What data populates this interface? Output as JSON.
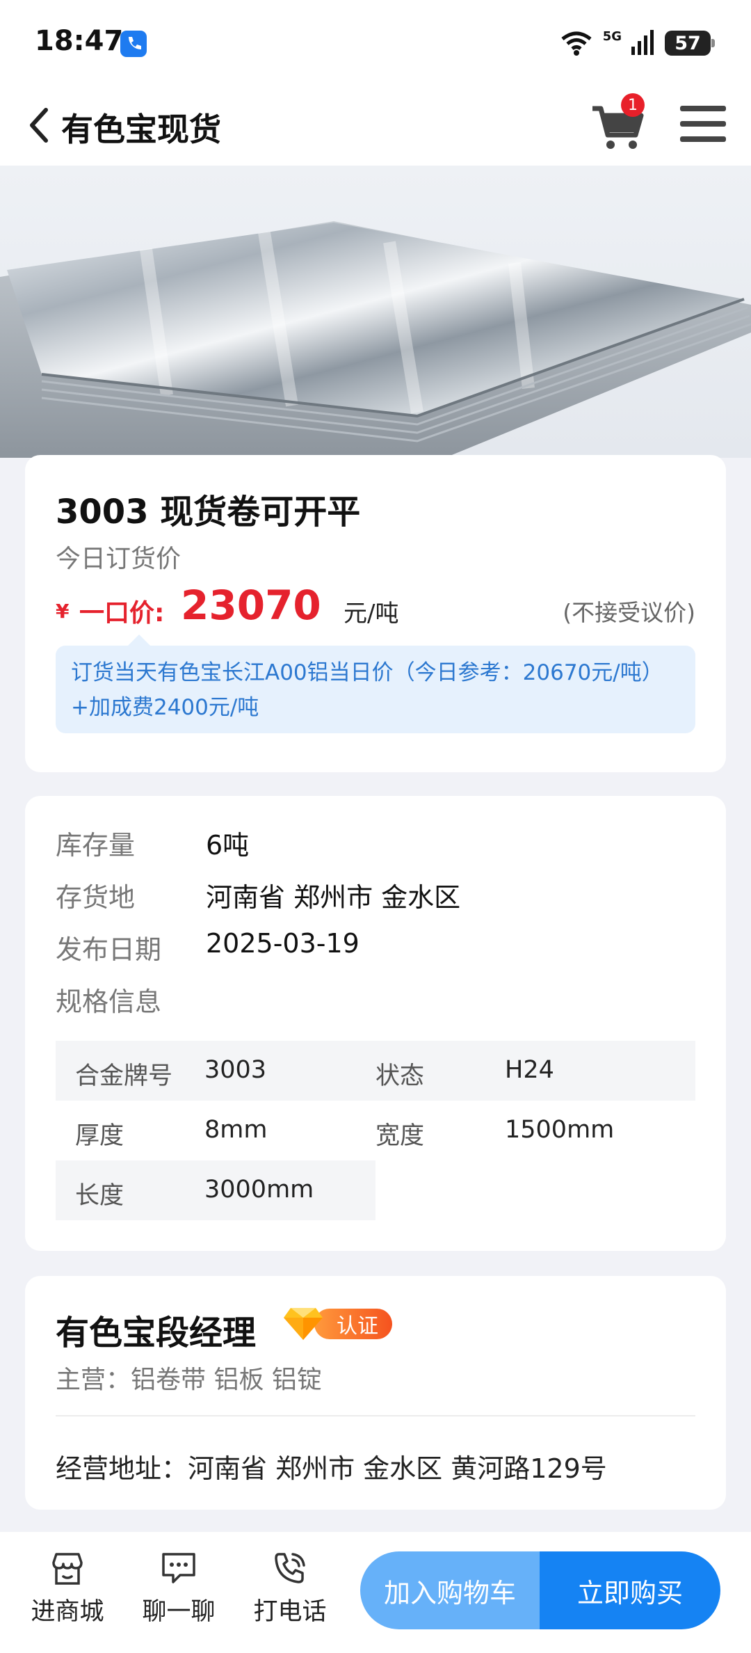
{
  "status_bar": {
    "time": "18:47",
    "network": "5G",
    "battery": "57"
  },
  "header": {
    "title": "有色宝现货",
    "cart_count": "1"
  },
  "product": {
    "title": "3003 现货卷可开平",
    "price_subtitle": "今日订货价",
    "currency_symbol": "¥",
    "price_label": "一口价:",
    "price_value": "23070",
    "price_unit": "元/吨",
    "price_note": "(不接受议价)",
    "price_info_line1": "订货当天有色宝长江A00铝当日价（今日参考：20670元/吨）",
    "price_info_line2": "+加成费2400元/吨"
  },
  "info": {
    "rows": [
      {
        "label": "库存量",
        "value": "6吨"
      },
      {
        "label": "存货地",
        "value": "河南省 郑州市 金水区"
      },
      {
        "label": "发布日期",
        "value": "2025-03-19"
      },
      {
        "label": "规格信息",
        "value": ""
      }
    ],
    "specs": [
      {
        "label": "合金牌号",
        "value": "3003"
      },
      {
        "label": "状态",
        "value": "H24"
      },
      {
        "label": "厚度",
        "value": "8mm"
      },
      {
        "label": "宽度",
        "value": "1500mm"
      },
      {
        "label": "长度",
        "value": "3000mm"
      }
    ]
  },
  "seller": {
    "name": "有色宝段经理",
    "cert_label": "认证",
    "business": "主营：铝卷带  铝板  铝锭",
    "address": "经营地址：河南省 郑州市 金水区 黄河路129号"
  },
  "bottom_bar": {
    "shop_label": "进商城",
    "chat_label": "聊一聊",
    "call_label": "打电话",
    "add_cart_label": "加入购物车",
    "buy_now_label": "立即购买"
  },
  "colors": {
    "accent_blue": "#1583f3",
    "light_blue": "#66b1f9",
    "price_red": "#e5222d",
    "badge_red": "#e8202a"
  }
}
